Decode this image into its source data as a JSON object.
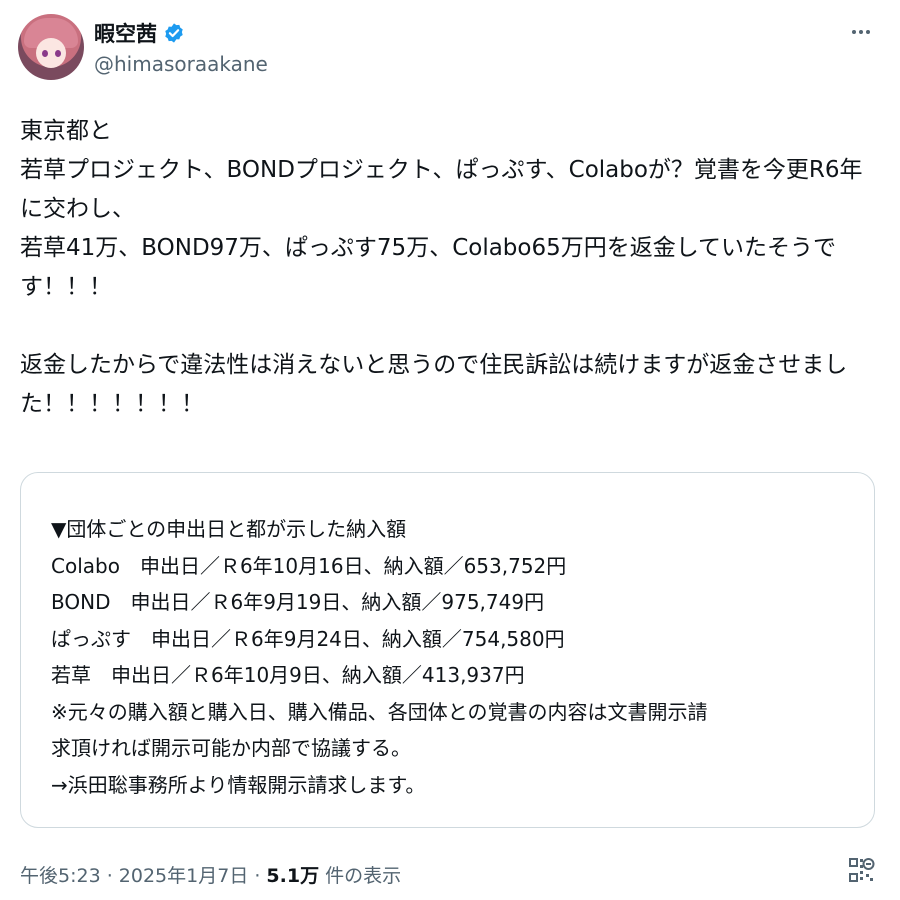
{
  "author": {
    "name": "暇空茜",
    "handle": "@himasoraakane",
    "verified_icon": "verified-badge-icon"
  },
  "tweet": {
    "text": "東京都と\n若草プロジェクト、BONDプロジェクト、ぱっぷす、Colaboが？覚書を今更R6年に交わし、\n若草41万、BOND97万、ぱっぷす75万、Colabo65万円を返金していたそうです！！！\n\n返金したからで違法性は消えないと思うので住民訴訟は続けますが返金させました！！！！！！！"
  },
  "card": {
    "text": "▼団体ごとの申出日と都が示した納入額\nColabo　申出日／Ｒ6年10月16日、納入額／653,752円\nBOND　申出日／Ｒ6年9月19日、納入額／975,749円\nぱっぷす　申出日／Ｒ6年9月24日、納入額／754,580円\n若草　申出日／Ｒ6年10月9日、納入額／413,937円\n※元々の購入額と購入日、購入備品、各団体との覚書の内容は文書開示請\n求頂ければ開示可能か内部で協議する。\n→浜田聡事務所より情報開示請求します。"
  },
  "footer": {
    "timestamp": "午後5:23 · 2025年1月7日 ·",
    "views_count": "5.1万",
    "views_label": "件の表示"
  },
  "colors": {
    "verified": "#1d9bf0",
    "secondary_text": "#536471",
    "card_border": "#cfd9de"
  }
}
